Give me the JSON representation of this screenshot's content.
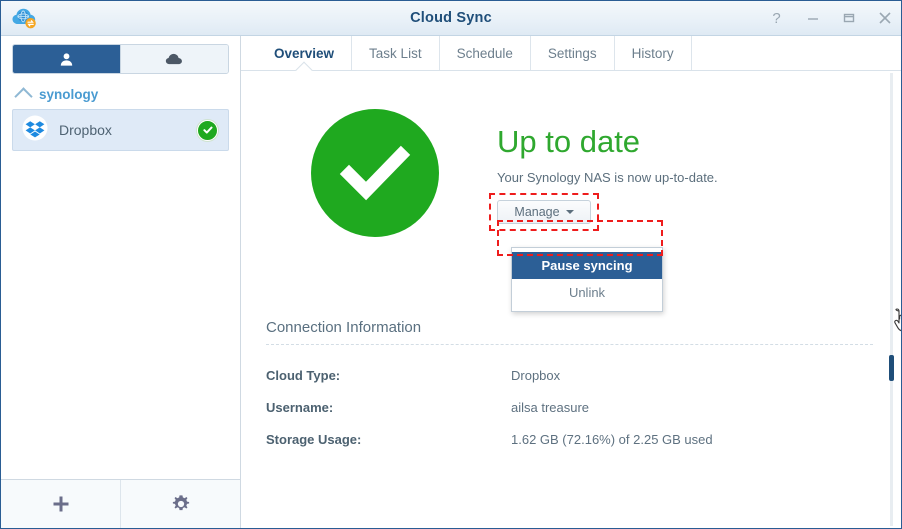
{
  "window": {
    "title": "Cloud Sync",
    "app_icon": "cloud-sync-icon",
    "controls": {
      "help": "?",
      "minimize": "minimize-icon",
      "maximize": "maximize-icon",
      "close": "close-icon"
    }
  },
  "sidebar": {
    "segmented": {
      "user_tab": "user-icon",
      "cloud_tab": "cloud-icon"
    },
    "group": {
      "label": "synology",
      "expanded": true
    },
    "accounts": [
      {
        "name": "Dropbox",
        "icon": "dropbox-icon",
        "status": "ok",
        "selected": true
      }
    ],
    "footer": {
      "add_label": "add-icon",
      "settings_label": "gear-icon"
    }
  },
  "tabs": [
    {
      "label": "Overview",
      "active": true
    },
    {
      "label": "Task List",
      "active": false
    },
    {
      "label": "Schedule",
      "active": false
    },
    {
      "label": "Settings",
      "active": false
    },
    {
      "label": "History",
      "active": false
    }
  ],
  "overview": {
    "status_icon": "check-circle-icon",
    "status_title": "Up to date",
    "status_subtitle": "Your Synology NAS is now up-to-date.",
    "manage_button": "Manage",
    "menu": [
      {
        "label": "Pause syncing",
        "highlighted": true
      },
      {
        "label": "Unlink",
        "highlighted": false
      }
    ]
  },
  "connection": {
    "heading": "Connection Information",
    "rows": [
      {
        "key": "Cloud Type:",
        "value": "Dropbox"
      },
      {
        "key": "Username:",
        "value": "ailsa treasure"
      },
      {
        "key": "Storage Usage:",
        "value": "1.62 GB (72.16%) of 2.25 GB used"
      }
    ]
  },
  "colors": {
    "accent_blue": "#2c5f96",
    "status_green": "#1fa91f",
    "annotation_red": "#ee1c1c",
    "title_blue": "#1f4e79"
  }
}
